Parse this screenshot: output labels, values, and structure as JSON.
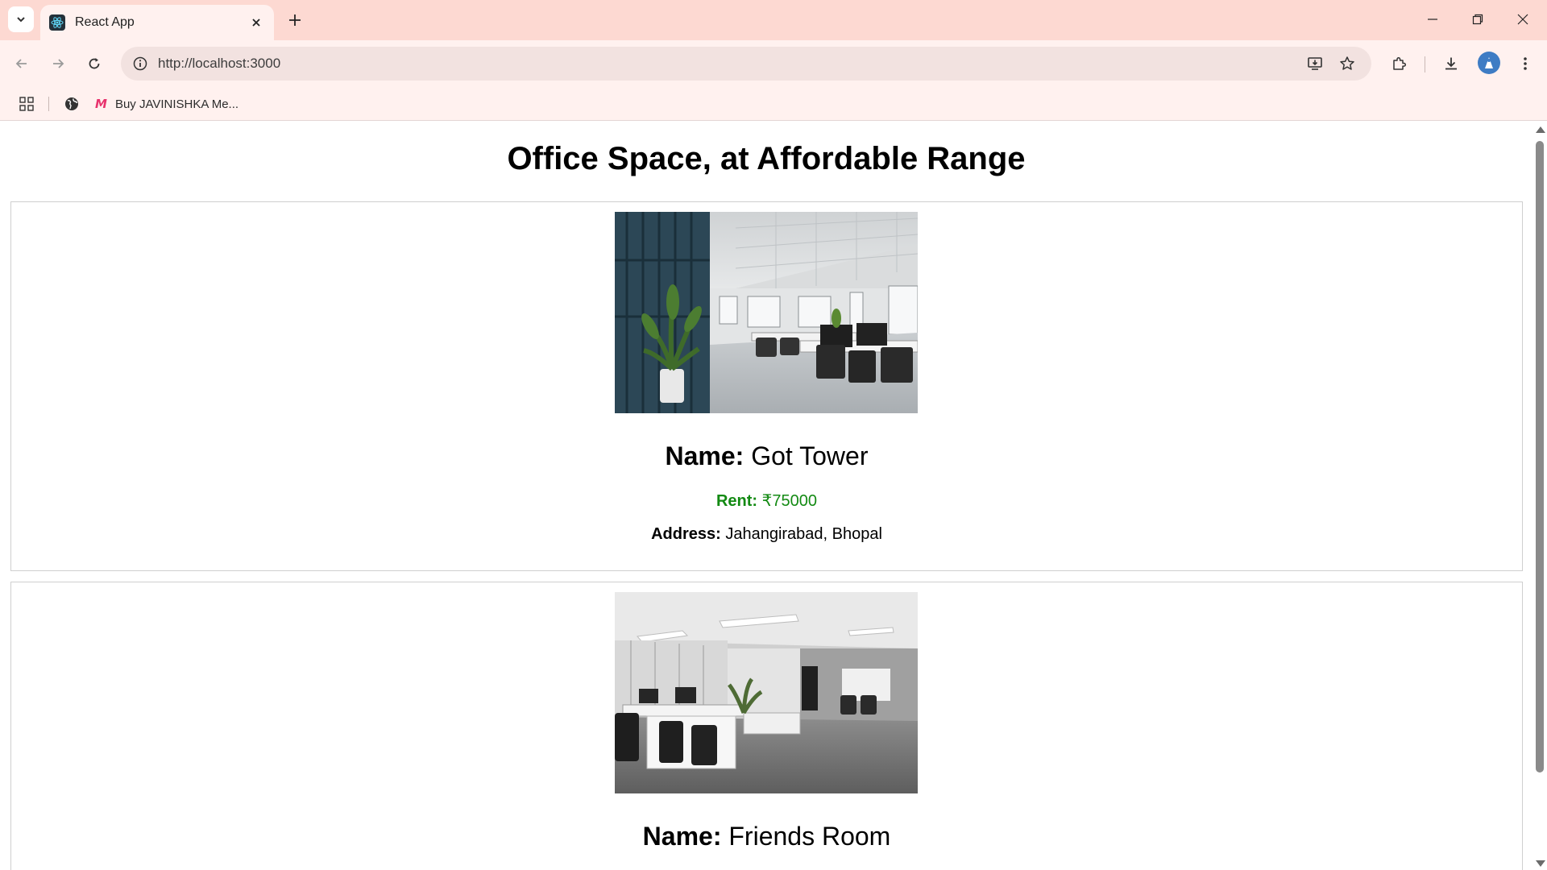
{
  "browser": {
    "tab_title": "React App",
    "url": "http://localhost:3000",
    "bookmark_label": "Buy JAVINISHKA Me...",
    "bookmark_favicon": "M"
  },
  "page": {
    "title": "Office Space, at Affordable Range",
    "name_label": "Name:",
    "rent_label": "Rent:",
    "address_label": "Address:",
    "rent_color": "#138a13"
  },
  "offices": [
    {
      "name": "Got Tower",
      "rent": "₹75000",
      "address": "Jahangirabad, Bhopal"
    },
    {
      "name": "Friends Room"
    }
  ]
}
